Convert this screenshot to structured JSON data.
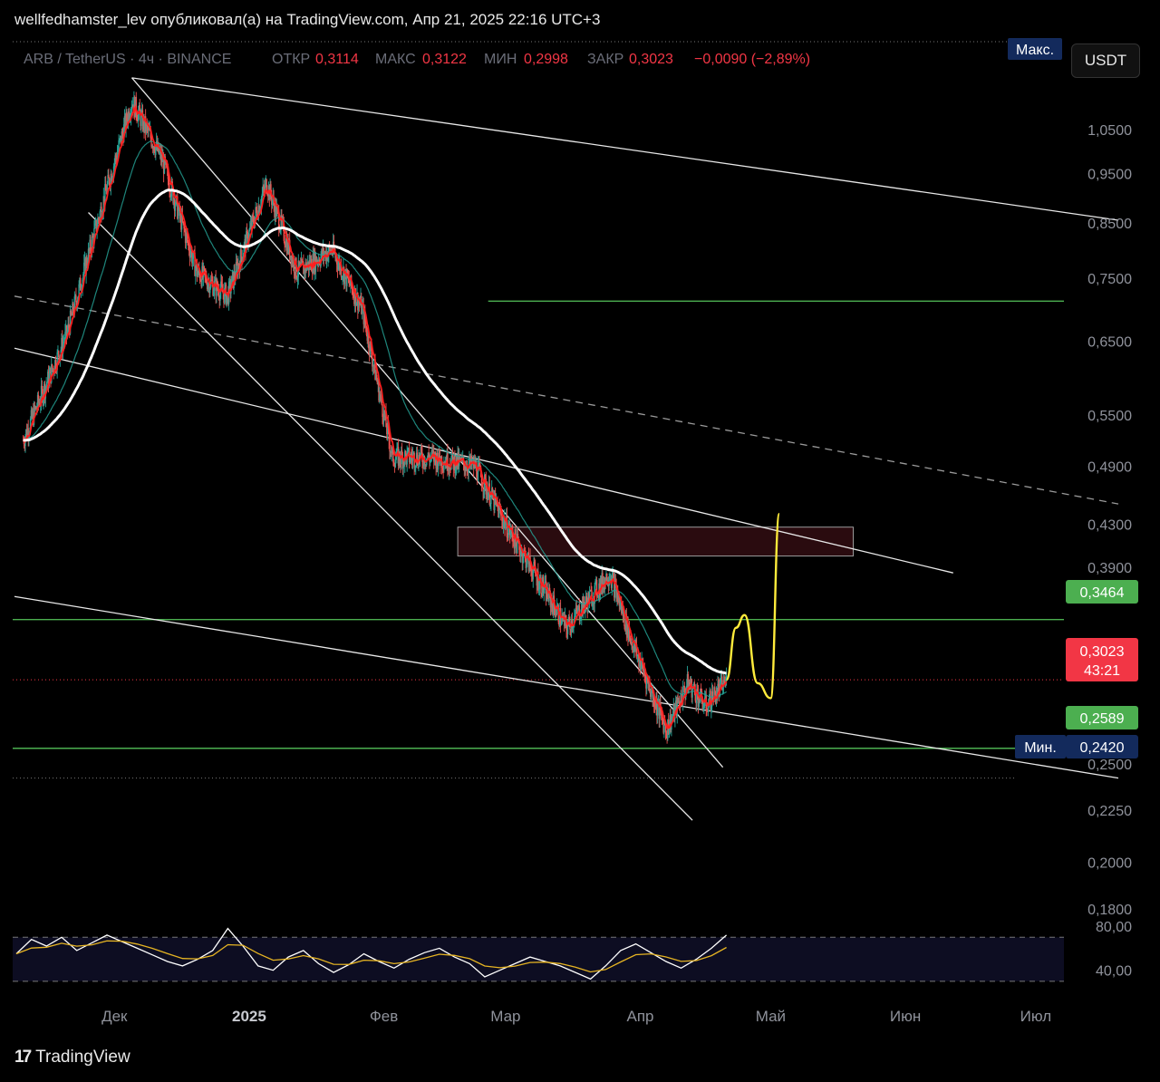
{
  "header": {
    "title": "wellfedhamster_lev опубликовал(а) на TradingView.com, Апр 21, 2025 22:16 UTC+3"
  },
  "legend": {
    "symbol": "ARB / TetherUS · 4ч · BINANCE",
    "open_label": "ОТКР",
    "open": "0,3114",
    "high_label": "МАКС",
    "high": "0,3122",
    "low_label": "МИН",
    "low": "0,2998",
    "close_label": "ЗАКР",
    "close": "0,3023",
    "change": "−0,0090 (−2,89%)"
  },
  "currency_button": "USDT",
  "markers": {
    "max_label": "Макс.",
    "min_label": "Мин.",
    "min_value": "0,2420"
  },
  "badges": {
    "level_high": "0,3464",
    "price": "0,3023",
    "countdown": "43:21",
    "level_low": "0,2589"
  },
  "colors": {
    "background": "#000000",
    "candle_up": "#26a69a",
    "candle_down": "#ef5350",
    "ema_fast": "#ff1e1e",
    "ema_slow": "#ffffff",
    "level_line": "#4caf50",
    "projection": "#ffeb3b",
    "price_badge": "#f23645",
    "marker_badge": "#132a5c",
    "rsi_line": "#ffffff",
    "rsi_ma": "#e6b422"
  },
  "chart_data": {
    "type": "candlestick",
    "title": "ARB / TetherUS",
    "y_scale": "log",
    "ylim": [
      0.195,
      1.17
    ],
    "price_ticks": [
      "1,0500",
      "0,9500",
      "0,8500",
      "0,7500",
      "0,6500",
      "0,5500",
      "0,4900",
      "0,4300",
      "0,3900",
      "0,3100",
      "0,2800",
      "0,2500",
      "0,2250",
      "0,2000",
      "0,1800"
    ],
    "x_labels": [
      "Дек",
      "2025",
      "Фев",
      "Мар",
      "Апр",
      "Май",
      "Июн",
      "Июл"
    ],
    "horizontal_levels": [
      0.712,
      0.3464,
      0.2589
    ],
    "current_price": 0.3023,
    "period_high_value": 1.18,
    "period_low_value": 0.242,
    "supply_zone": {
      "from": 0.4,
      "to": 0.427
    },
    "trend": [
      {
        "date": "2024-11-10",
        "close": 0.52
      },
      {
        "date": "2024-11-20",
        "close": 0.66
      },
      {
        "date": "2024-11-28",
        "close": 0.88
      },
      {
        "date": "2024-12-05",
        "close": 1.12
      },
      {
        "date": "2024-12-12",
        "close": 0.98
      },
      {
        "date": "2024-12-20",
        "close": 0.76
      },
      {
        "date": "2024-12-27",
        "close": 0.72
      },
      {
        "date": "2025-01-05",
        "close": 0.93
      },
      {
        "date": "2025-01-12",
        "close": 0.76
      },
      {
        "date": "2025-01-20",
        "close": 0.8
      },
      {
        "date": "2025-01-27",
        "close": 0.7
      },
      {
        "date": "2025-02-03",
        "close": 0.5
      },
      {
        "date": "2025-02-12",
        "close": 0.5
      },
      {
        "date": "2025-02-22",
        "close": 0.49
      },
      {
        "date": "2025-03-01",
        "close": 0.43
      },
      {
        "date": "2025-03-10",
        "close": 0.37
      },
      {
        "date": "2025-03-15",
        "close": 0.34
      },
      {
        "date": "2025-03-25",
        "close": 0.385
      },
      {
        "date": "2025-03-30",
        "close": 0.33
      },
      {
        "date": "2025-04-07",
        "close": 0.27
      },
      {
        "date": "2025-04-12",
        "close": 0.3
      },
      {
        "date": "2025-04-16",
        "close": 0.285
      },
      {
        "date": "2025-04-21",
        "close": 0.3023
      }
    ],
    "projection": [
      {
        "date": "2025-04-23",
        "value": 0.34
      },
      {
        "date": "2025-04-25",
        "value": 0.35
      },
      {
        "date": "2025-04-28",
        "value": 0.3
      },
      {
        "date": "2025-05-01",
        "value": 0.29
      },
      {
        "date": "2025-05-03",
        "value": 0.44
      }
    ],
    "rsi": {
      "ticks": [
        "80,00",
        "40,00"
      ],
      "band": [
        30,
        70
      ],
      "values": [
        55,
        68,
        62,
        70,
        58,
        65,
        72,
        66,
        60,
        54,
        48,
        44,
        50,
        58,
        78,
        62,
        44,
        40,
        52,
        58,
        46,
        38,
        45,
        55,
        48,
        42,
        50,
        56,
        60,
        52,
        46,
        34,
        40,
        46,
        52,
        48,
        44,
        38,
        32,
        44,
        58,
        64,
        56,
        48,
        42,
        50,
        60,
        72
      ]
    }
  }
}
